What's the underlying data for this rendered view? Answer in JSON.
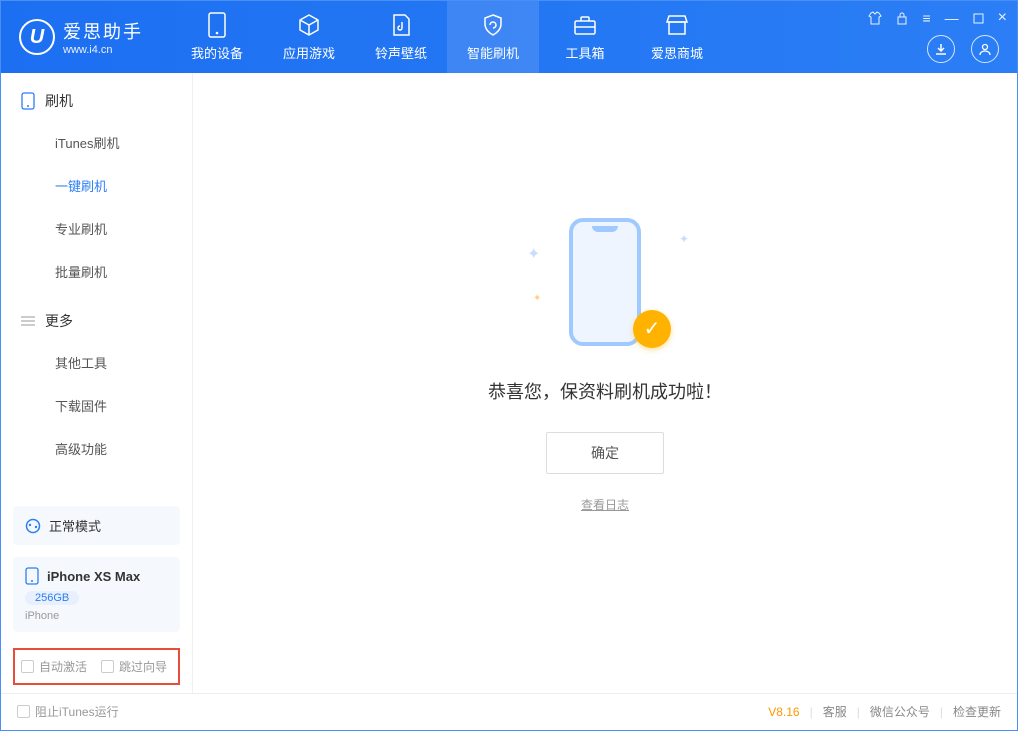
{
  "brand": {
    "title": "爱思助手",
    "subtitle": "www.i4.cn",
    "logo_letter": "U"
  },
  "nav": [
    {
      "label": "我的设备"
    },
    {
      "label": "应用游戏"
    },
    {
      "label": "铃声壁纸"
    },
    {
      "label": "智能刷机"
    },
    {
      "label": "工具箱"
    },
    {
      "label": "爱思商城"
    }
  ],
  "sidebar": {
    "section1": {
      "title": "刷机",
      "items": [
        "iTunes刷机",
        "一键刷机",
        "专业刷机",
        "批量刷机"
      ],
      "active_index": 1
    },
    "section2": {
      "title": "更多",
      "items": [
        "其他工具",
        "下载固件",
        "高级功能"
      ]
    }
  },
  "mode": {
    "label": "正常模式"
  },
  "device": {
    "name": "iPhone XS Max",
    "capacity": "256GB",
    "type": "iPhone"
  },
  "checkboxes": {
    "auto_activate": "自动激活",
    "skip_guide": "跳过向导"
  },
  "main": {
    "success_message": "恭喜您，保资料刷机成功啦！",
    "ok_button": "确定",
    "view_log": "查看日志"
  },
  "footer": {
    "block_itunes": "阻止iTunes运行",
    "version": "V8.16",
    "links": [
      "客服",
      "微信公众号",
      "检查更新"
    ]
  }
}
